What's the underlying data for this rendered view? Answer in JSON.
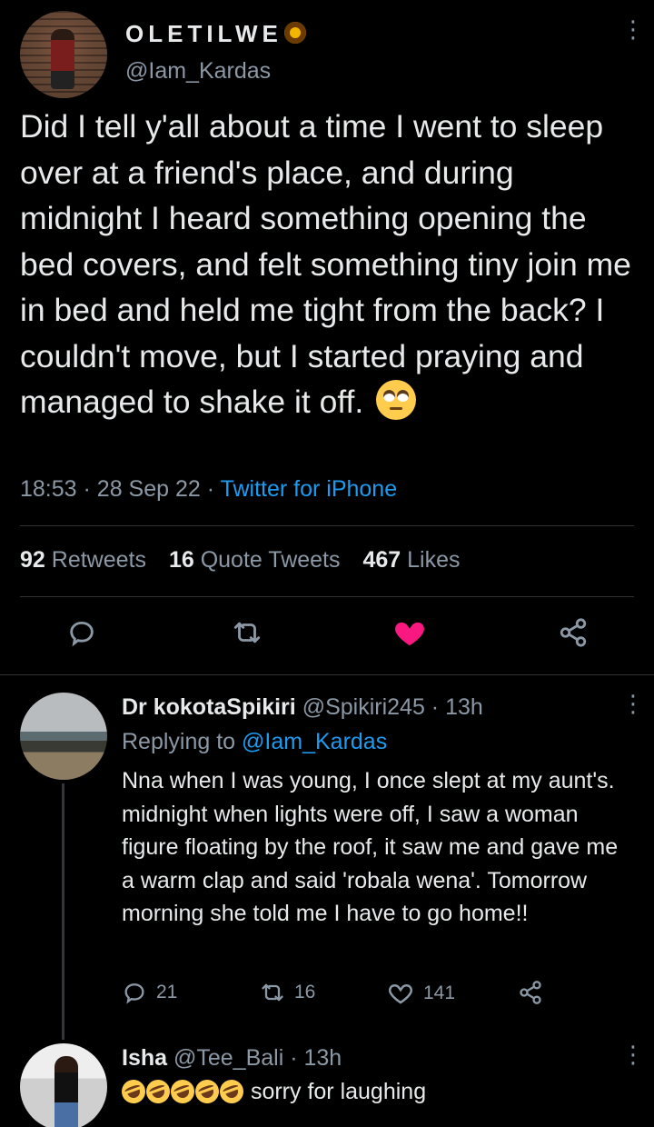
{
  "main_tweet": {
    "display_name": "OLETILWE",
    "name_emoji": "sunflower",
    "handle": "@Iam_Kardas",
    "text": "Did I tell y'all about a time I went to sleep over at a friend's place, and during midnight I heard something opening the bed covers, and felt something tiny join me in bed and held me tight from the back? I couldn't move, but I started praying and managed to shake it off.",
    "text_emoji": "face-with-rolling-eyes",
    "time": "18:53",
    "date": "28 Sep 22",
    "source": "Twitter for iPhone",
    "stats": {
      "retweets_count": "92",
      "retweets_label": "Retweets",
      "quotes_count": "16",
      "quotes_label": "Quote Tweets",
      "likes_count": "467",
      "likes_label": "Likes"
    },
    "liked": true
  },
  "replies": [
    {
      "name": "Dr kokotaSpikiri",
      "handle": "@Spikiri245",
      "time": "13h",
      "replying_label": "Replying to",
      "replying_to": "@Iam_Kardas",
      "text": "Nna when I was young, I once slept at my aunt's. midnight when lights were off,  I saw a woman figure floating by the roof, it saw me and gave me a warm clap and said 'robala wena'. Tomorrow morning she told me I have to go home!!",
      "replies_count": "21",
      "retweets_count": "16",
      "likes_count": "141"
    },
    {
      "name": "Isha",
      "handle": "@Tee_Bali",
      "time": "13h",
      "emoji": "rolling-on-the-floor-laughing",
      "text": "sorry for laughing"
    }
  ],
  "colors": {
    "background": "#000000",
    "text": "#e7e9ea",
    "muted": "#8b98a5",
    "link": "#1d9bf0",
    "like": "#f91880",
    "divider": "#2f3336"
  }
}
